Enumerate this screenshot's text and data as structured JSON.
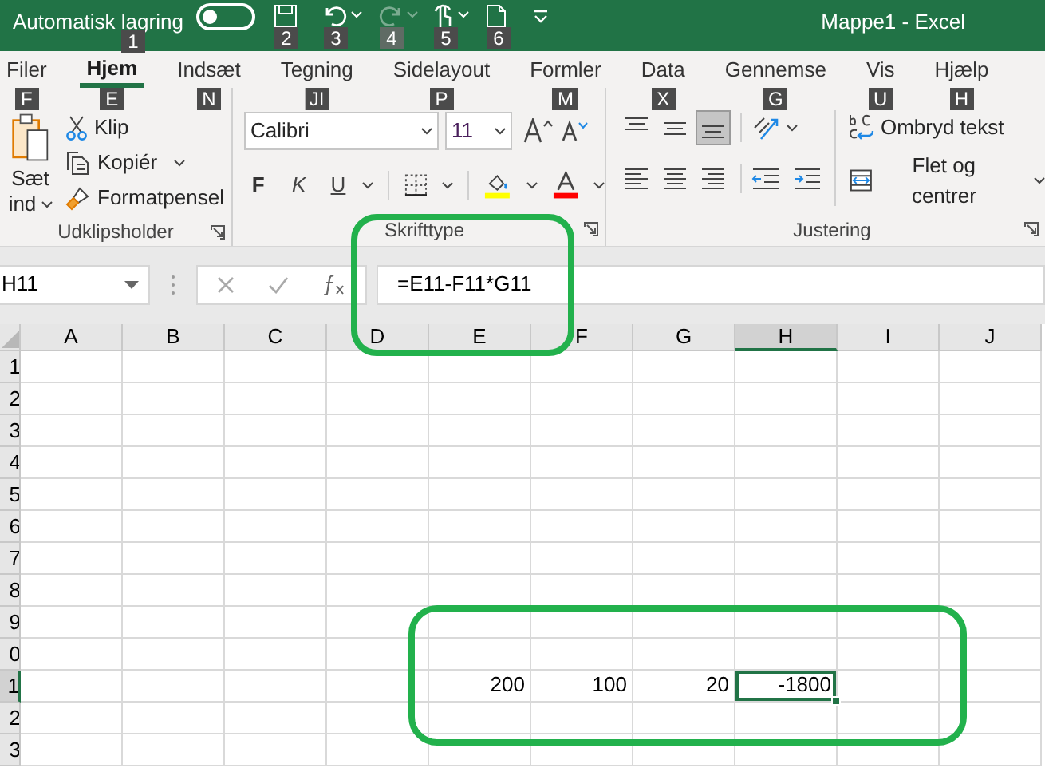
{
  "title_bar": {
    "autosave_label": "Automatisk lagring",
    "autosave_keytip": "1",
    "autosave_on": false,
    "quick_access": [
      {
        "kind": "save",
        "keytip": "2",
        "disabled": false
      },
      {
        "kind": "undo",
        "keytip": "3",
        "disabled": false
      },
      {
        "kind": "redo",
        "keytip": "4",
        "disabled": true
      },
      {
        "kind": "touch",
        "keytip": "5",
        "disabled": false
      },
      {
        "kind": "new",
        "keytip": "6",
        "disabled": false
      },
      {
        "kind": "customize",
        "disabled": false
      }
    ],
    "title": "Mappe1 - Excel"
  },
  "tabs": [
    {
      "label": "Filer",
      "keytip": "F",
      "selected": false
    },
    {
      "label": "Hjem",
      "keytip": "E",
      "selected": true
    },
    {
      "label": "Indsæt",
      "keytip": "N",
      "selected": false
    },
    {
      "label": "Tegning",
      "keytip": "JI",
      "selected": false
    },
    {
      "label": "Sidelayout",
      "keytip": "P",
      "selected": false
    },
    {
      "label": "Formler",
      "keytip": "M",
      "selected": false
    },
    {
      "label": "Data",
      "keytip": "X",
      "selected": false
    },
    {
      "label": "Gennemse",
      "keytip": "G",
      "selected": false
    },
    {
      "label": "Vis",
      "keytip": "U",
      "selected": false
    },
    {
      "label": "Hjælp",
      "keytip": "H",
      "selected": false
    }
  ],
  "ribbon": {
    "clipboard": {
      "paste_line_1": "Sæt",
      "paste_line_2": "ind",
      "cut": "Klip",
      "copy": "Kopiér",
      "format_painter": "Formatpensel",
      "label": "Udklipsholder"
    },
    "font": {
      "font_name": "Calibri",
      "font_size": "11",
      "bold": "F",
      "italic": "K",
      "underline": "U",
      "label": "Skrifttype"
    },
    "alignment": {
      "vertical": [
        {
          "kind": "top",
          "selected": false
        },
        {
          "kind": "middle",
          "selected": false
        },
        {
          "kind": "bottom",
          "selected": true
        }
      ],
      "horizontal": [
        {
          "kind": "left",
          "selected": false
        },
        {
          "kind": "center",
          "selected": false
        },
        {
          "kind": "right",
          "selected": false
        }
      ],
      "wrap_text": "Ombryd tekst",
      "merge": "Flet og centrer",
      "label": "Justering"
    }
  },
  "formula_bar": {
    "name_box": "H11",
    "formula": "=E11-F11*G11"
  },
  "sheet": {
    "columns": [
      {
        "label": "A",
        "selected": false
      },
      {
        "label": "B",
        "selected": false
      },
      {
        "label": "C",
        "selected": false
      },
      {
        "label": "D",
        "selected": false
      },
      {
        "label": "E",
        "selected": false
      },
      {
        "label": "F",
        "selected": false
      },
      {
        "label": "G",
        "selected": false
      },
      {
        "label": "H",
        "selected": true
      },
      {
        "label": "I",
        "selected": false
      },
      {
        "label": "J",
        "selected": false
      }
    ],
    "rows": [
      {
        "label": "1",
        "selected": false
      },
      {
        "label": "2",
        "selected": false
      },
      {
        "label": "3",
        "selected": false
      },
      {
        "label": "4",
        "selected": false
      },
      {
        "label": "5",
        "selected": false
      },
      {
        "label": "6",
        "selected": false
      },
      {
        "label": "7",
        "selected": false
      },
      {
        "label": "8",
        "selected": false
      },
      {
        "label": "9",
        "selected": false
      },
      {
        "label": "0",
        "selected": false
      },
      {
        "label": "1",
        "selected": true,
        "cells": {
          "E": "200",
          "F": "100",
          "G": "20",
          "H": "-1800"
        }
      },
      {
        "label": "2",
        "selected": false
      },
      {
        "label": "3",
        "selected": false
      }
    ]
  }
}
